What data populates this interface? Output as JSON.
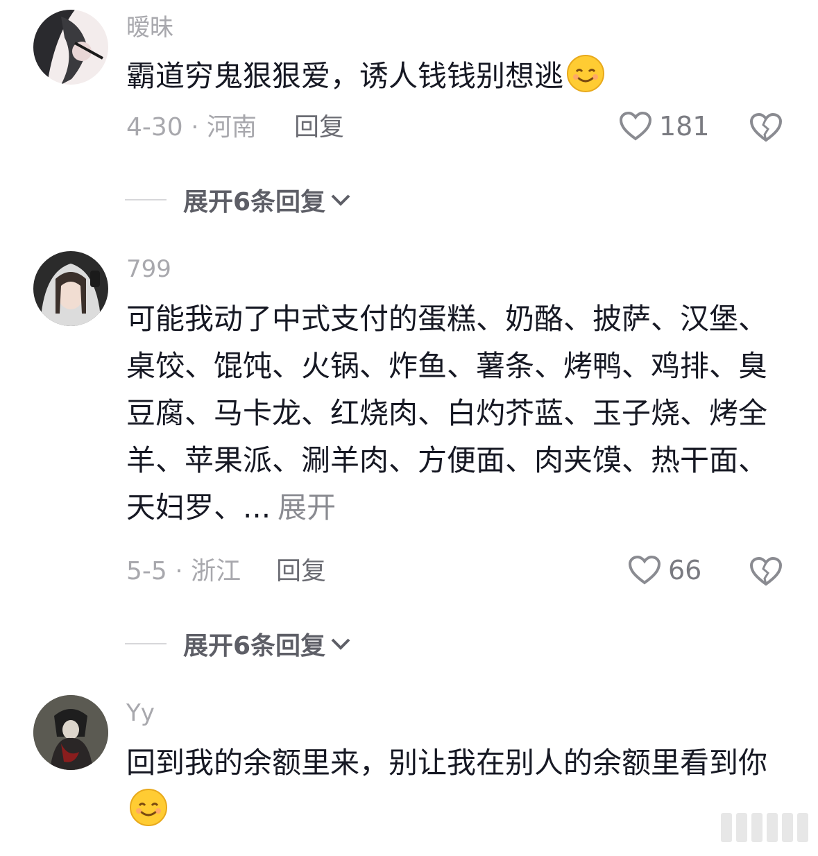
{
  "comments": [
    {
      "username": "暧昧",
      "text": "霸道穷鬼狠狠爱，诱人钱钱别想逃",
      "date_loc": "4-30 · 河南",
      "reply_label": "回复",
      "likes": "181",
      "expand_replies": "展开6条回复"
    },
    {
      "username": "799",
      "text": "可能我动了中式支付的蛋糕、奶酪、披萨、汉堡、桌饺、馄饨、火锅、炸鱼、薯条、烤鸭、鸡排、臭豆腐、马卡龙、红烧肉、白灼芥蓝、玉子烧、烤全羊、苹果派、涮羊肉、方便面、肉夹馍、热干面、天妇罗、...",
      "more_label": "展开",
      "date_loc": "5-5 · 浙江",
      "reply_label": "回复",
      "likes": "66",
      "expand_replies": "展开6条回复"
    },
    {
      "username": "Yy",
      "text": "回到我的余额里来，别让我在别人的余额里看到你"
    }
  ],
  "icons": {
    "like": "heart-outline-icon",
    "dislike": "broken-heart-icon",
    "emoji": "smile-emoji"
  },
  "colors": {
    "username": "#a8a8ad",
    "text": "#161823",
    "meta": "#a8a8ad",
    "emoji_face": "#ffcc33"
  }
}
